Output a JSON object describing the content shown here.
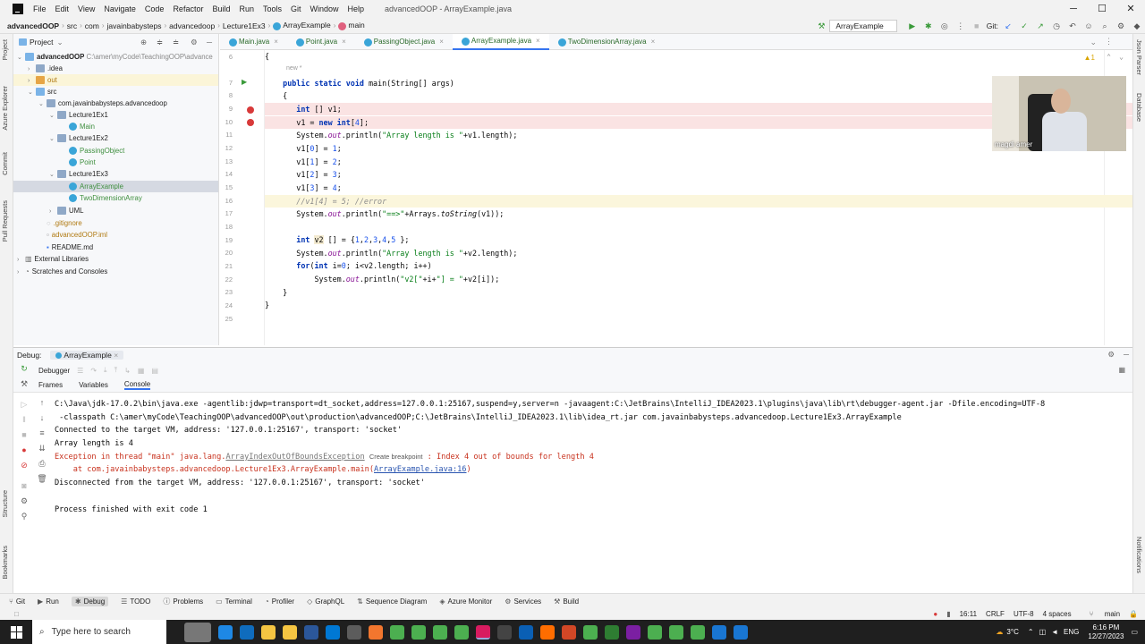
{
  "menu": {
    "items": [
      "File",
      "Edit",
      "View",
      "Navigate",
      "Code",
      "Refactor",
      "Build",
      "Run",
      "Tools",
      "Git",
      "Window",
      "Help"
    ],
    "window_title": "advancedOOP - ArrayExample.java"
  },
  "nav": {
    "breadcrumbs": [
      "advancedOOP",
      "src",
      "com",
      "javainbabysteps",
      "advancedoop",
      "Lecture1Ex3",
      "ArrayExample",
      "main"
    ],
    "run_config": "ArrayExample",
    "git_label": "Git:"
  },
  "project": {
    "title": "Project",
    "rows": [
      {
        "text": "advancedOOP",
        "extra": "C:\\amer\\myCode\\TeachingOOP\\advance"
      },
      {
        "text": ".idea"
      },
      {
        "text": "out"
      },
      {
        "text": "src"
      },
      {
        "text": "com.javainbabysteps.advancedoop"
      },
      {
        "text": "Lecture1Ex1"
      },
      {
        "text": "Main"
      },
      {
        "text": "Lecture1Ex2"
      },
      {
        "text": "PassingObject"
      },
      {
        "text": "Point"
      },
      {
        "text": "Lecture1Ex3"
      },
      {
        "text": "ArrayExample"
      },
      {
        "text": "TwoDimensionArray"
      },
      {
        "text": "UML"
      },
      {
        "text": ".gitignore"
      },
      {
        "text": "advancedOOP.iml"
      },
      {
        "text": "README.md"
      },
      {
        "text": "External Libraries"
      },
      {
        "text": "Scratches and Consoles"
      }
    ]
  },
  "editor": {
    "tabs": [
      "Main.java",
      "Point.java",
      "PassingObject.java",
      "ArrayExample.java",
      "TwoDimensionArray.java"
    ],
    "line_numbers": [
      "6",
      "7",
      "8",
      "9",
      "10",
      "11",
      "12",
      "13",
      "14",
      "15",
      "16",
      "17",
      "18",
      "19",
      "20",
      "21",
      "22",
      "23",
      "24",
      "25"
    ],
    "hint_new": "new *",
    "warning_count": "1"
  },
  "webcam": {
    "name": "magdi amer"
  },
  "debug": {
    "title": "Debug:",
    "config": "ArrayExample",
    "debugger_tab": "Debugger",
    "subtabs": [
      "Frames",
      "Variables",
      "Console"
    ],
    "console": {
      "l1": "C:\\Java\\jdk-17.0.2\\bin\\java.exe -agentlib:jdwp=transport=dt_socket,address=127.0.0.1:25167,suspend=y,server=n -javaagent:C:\\JetBrains\\IntelliJ_IDEA2023.1\\plugins\\java\\lib\\rt\\debugger-agent.jar -Dfile.encoding=UTF-8",
      "l2": " -classpath C:\\amer\\myCode\\TeachingOOP\\advancedOOP\\out\\production\\advancedOOP;C:\\JetBrains\\IntelliJ_IDEA2023.1\\lib\\idea_rt.jar com.javainbabysteps.advancedoop.Lecture1Ex3.ArrayExample",
      "l3": "Connected to the target VM, address: '127.0.0.1:25167', transport: 'socket'",
      "l4": "Array length is 4",
      "l5a": "Exception in thread \"main\" java.lang.",
      "l5b": "ArrayIndexOutOfBoundsException",
      "l5c": "Create breakpoint",
      "l5d": " : Index 4 out of bounds for length 4",
      "l6a": "    at com.javainbabysteps.advancedoop.Lecture1Ex3.ArrayExample.main(",
      "l6b": "ArrayExample.java:16",
      "l6c": ")",
      "l7": "Disconnected from the target VM, address: '127.0.0.1:25167', transport: 'socket'",
      "l8": "Process finished with exit code 1"
    }
  },
  "tooltabs": [
    "Git",
    "Run",
    "Debug",
    "TODO",
    "Problems",
    "Terminal",
    "Profiler",
    "GraphQL",
    "Sequence Diagram",
    "Azure Monitor",
    "Services",
    "Build"
  ],
  "status": {
    "position": "16:11",
    "line_sep": "CRLF",
    "encoding": "UTF-8",
    "indent": "4 spaces",
    "branch": "main"
  },
  "taskbar": {
    "search": "Type here to search",
    "temp": "3°C",
    "lang": "ENG",
    "time": "6:16 PM",
    "date": "12/27/2023"
  },
  "left_tabs": [
    "Project",
    "Azure Explorer",
    "Commit",
    "Pull Requests",
    "Structure",
    "Bookmarks"
  ],
  "right_tabs": [
    "Json Parser",
    "Database",
    "Notifications"
  ]
}
